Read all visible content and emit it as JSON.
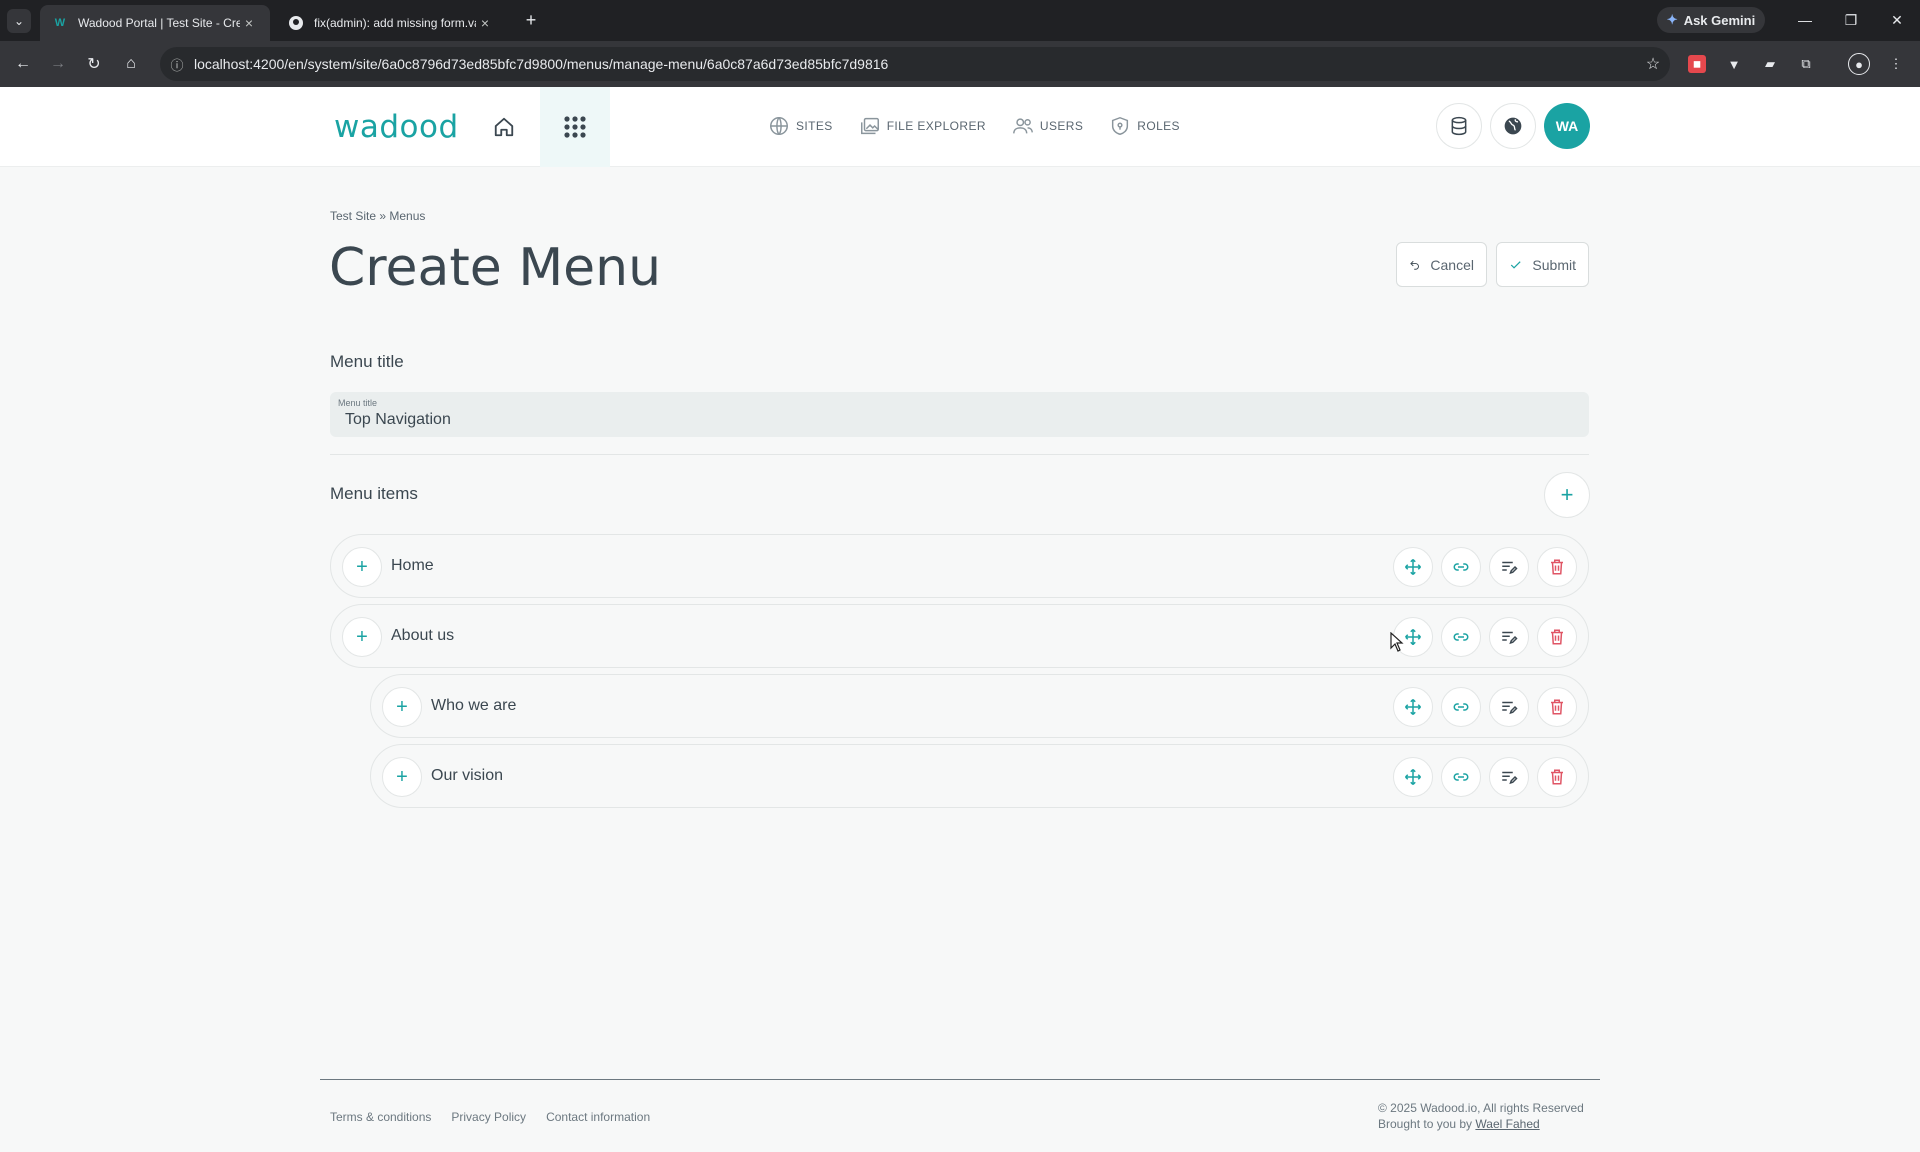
{
  "browser": {
    "tabs": [
      {
        "title": "Wadood Portal | Test Site - Create",
        "active": true
      },
      {
        "title": "fix(admin): add missing form.va",
        "active": false
      }
    ],
    "new_tab_icon": "plus-icon",
    "gemini_label": "Ask Gemini",
    "url": "localhost:4200/en/system/site/6a0c8796d73ed85bfc7d9800/menus/manage-menu/6a0c87a6d73ed85bfc7d9816"
  },
  "app": {
    "logo": "wadood",
    "brand_color": "#1aa3a3",
    "nav": [
      {
        "label": "SITES",
        "icon": "globe-icon"
      },
      {
        "label": "FILE EXPLORER",
        "icon": "images-icon"
      },
      {
        "label": "USERS",
        "icon": "users-icon"
      },
      {
        "label": "ROLES",
        "icon": "shield-icon"
      }
    ],
    "avatar_initials": "WA"
  },
  "page": {
    "breadcrumb": [
      {
        "label": "Test Site",
        "separator": ""
      },
      {
        "label": "Menus",
        "separator": "» "
      }
    ],
    "title": "Create Menu",
    "cancel_label": "Cancel",
    "submit_label": "Submit",
    "menu_title_section": "Menu title",
    "menu_title_field_label": "Menu title",
    "menu_title_value": "Top Navigation",
    "menu_items_section": "Menu items",
    "items": [
      {
        "label": "Home",
        "level": 0
      },
      {
        "label": "About us",
        "level": 0
      },
      {
        "label": "Who we are",
        "level": 1
      },
      {
        "label": "Our vision",
        "level": 1
      }
    ],
    "item_actions": [
      "move-icon",
      "link-icon",
      "edit-list-icon",
      "trash-icon"
    ],
    "delete_color": "#e05565"
  },
  "footer": {
    "links": [
      "Terms & conditions",
      "Privacy Policy",
      "Contact information"
    ],
    "copyright": "© 2025 Wadood.io, All rights Reserved",
    "credit_prefix": "Brought to you by",
    "credit_author": "Wael Fahed"
  }
}
